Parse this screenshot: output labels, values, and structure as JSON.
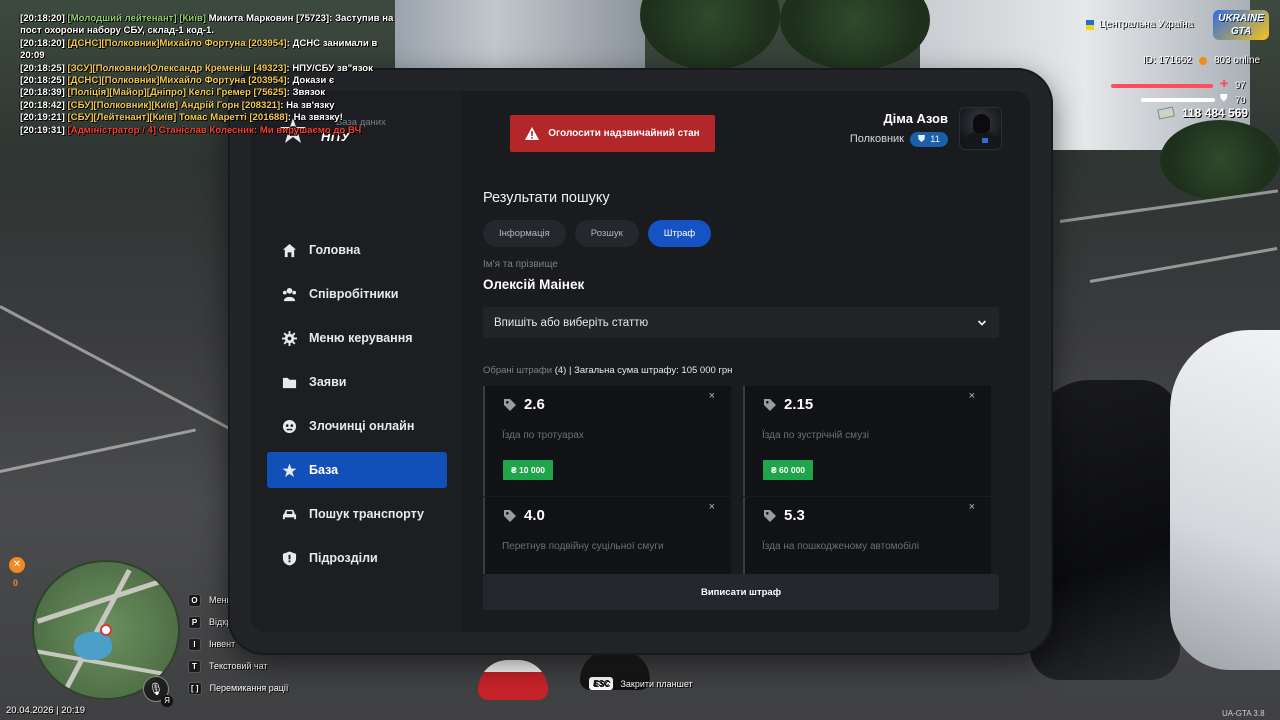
{
  "chat": [
    {
      "time": "[20:18:20]",
      "tag": "[Молодший лейтенант] [Київ]",
      "name": " Микита Марковин [75723]",
      "msg": ": Заступив на пост охорони набору СБУ, склад-1 код-1.",
      "color": "green"
    },
    {
      "time": "[20:18:20]",
      "tag": "[ДСНС][Полковник]Михайло Фортуна [203954]",
      "name": "",
      "msg": ": ДСНС занимали в 20:09",
      "color": "yellow"
    },
    {
      "time": "[20:18:25]",
      "tag": "[ЗСУ][Полковник]Олександр Кременiш [49323]",
      "name": "",
      "msg": ": НПУ/СБУ зв\"язок",
      "color": "yellow"
    },
    {
      "time": "[20:18:25]",
      "tag": "[ДСНС][Полковник]Михайло Фортуна [203954]",
      "name": "",
      "msg": ": Докази є",
      "color": "yellow"
    },
    {
      "time": "[20:18:39]",
      "tag": "[Поліція][Майор][Дніпро] Келсі Гремер [75625]",
      "name": "",
      "msg": ": Звязок",
      "color": "yellow"
    },
    {
      "time": "[20:18:42]",
      "tag": "[СБУ][Полковник][Київ] Андрій Горн [208321]",
      "name": "",
      "msg": ": На зв'язку",
      "color": "yellow"
    },
    {
      "time": "[20:19:21]",
      "tag": "[СБУ][Лейтенант][Київ] Томас Маретті [201688]",
      "name": "",
      "msg": ": На звязку!",
      "color": "yellow"
    },
    {
      "time": "[20:19:31]",
      "tag": "[Адміністратор / 4] Станіслав Колесник",
      "name": "",
      "msg": ": Ми вирушаємо до ВЧ",
      "color": "red"
    }
  ],
  "hud": {
    "region": "Центральна Україна",
    "logo_line1": "UKRAINE",
    "logo_line2": "GTA",
    "player_id": "ID: 171662",
    "online": "803 online",
    "health": "97",
    "health_fraction": 0.97,
    "armor": "70",
    "armor_fraction": 0.7,
    "money": "118 484 569",
    "hunger_value": "0",
    "datetime": "20.04.2026 | 20:19",
    "version": "UA-GTA 3.8",
    "mic_key": "Я",
    "esc_key": "ESC",
    "esc_label": "Закрити планшет",
    "keys": [
      {
        "key": "O",
        "label": "Меню"
      },
      {
        "key": "P",
        "label": "Відкр"
      },
      {
        "key": "I",
        "label": "Інвент"
      },
      {
        "key": "T",
        "label": "Текстовий чат"
      },
      {
        "key": "[  ]",
        "label": "Перемикання рації"
      }
    ]
  },
  "tablet": {
    "brand_subtitle": "База даних",
    "brand_title": "НПУ",
    "emergency_button": "Оголосити надзвичайний стан",
    "profile": {
      "name": "Діма Азов",
      "rank": "Полковник",
      "level": "11"
    },
    "nav": [
      {
        "label": "Головна",
        "icon": "home-icon",
        "active": false
      },
      {
        "label": "Співробітники",
        "icon": "users-icon",
        "active": false
      },
      {
        "label": "Меню керування",
        "icon": "gear-icon",
        "active": false
      },
      {
        "label": "Заяви",
        "icon": "folder-icon",
        "active": false
      },
      {
        "label": "Злочинці онлайн",
        "icon": "mask-icon",
        "active": false
      },
      {
        "label": "База",
        "icon": "star-icon",
        "active": true
      },
      {
        "label": "Пошук транспорту",
        "icon": "car-icon",
        "active": false
      },
      {
        "label": "Підрозділи",
        "icon": "shield-icon",
        "active": false
      }
    ],
    "results_title": "Результати пошуку",
    "tabs": [
      {
        "label": "Інформація",
        "active": false
      },
      {
        "label": "Розшук",
        "active": false
      },
      {
        "label": "Штраф",
        "active": true
      }
    ],
    "name_label": "Ім'я та прізвище",
    "person_name": "Олексій Маінек",
    "article_select": "Впишіть або виберіть статтю",
    "fines_label": "Обрані штрафи",
    "fines_count": "(4)",
    "fines_total": "| Загальна сума штрафу: 105 000 грн",
    "fines": [
      {
        "code": "2.6",
        "desc": "Їзда по тротуарах",
        "amount": "₴ 10 000"
      },
      {
        "code": "2.15",
        "desc": "Їзда по зустрічній смузі",
        "amount": "₴ 60 000"
      },
      {
        "code": "4.0",
        "desc": "Перетнув подвійну суцільної смуги",
        "amount": ""
      },
      {
        "code": "5.3",
        "desc": "Їзда на пошкодженому автомобілі",
        "amount": ""
      }
    ],
    "issue_button": "Виписати штраф"
  },
  "colors": {
    "accent": "#1553c2",
    "nav_active": "#1150b8",
    "emergency": "#b3262a",
    "fine_amount": "#1fa64a",
    "health": "#ff4d5e"
  }
}
